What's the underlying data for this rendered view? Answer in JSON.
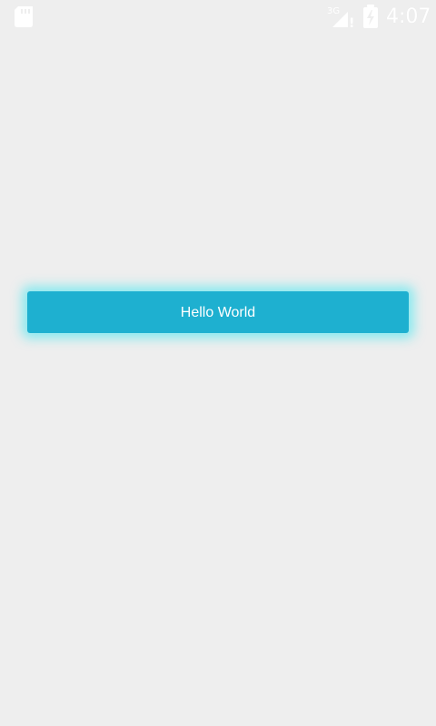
{
  "status_bar": {
    "time": "4:07",
    "network_type": "3G",
    "network_alert": "!",
    "icons": {
      "left": "sd-card-icon",
      "signal": "network-signal-icon",
      "battery": "battery-charging-icon"
    },
    "icon_color": "#ffffff"
  },
  "main": {
    "button_label": "Hello World",
    "button_color": "#1eb0d0",
    "button_glow_color": "#38e6f0",
    "background_color": "#eeeeee"
  }
}
